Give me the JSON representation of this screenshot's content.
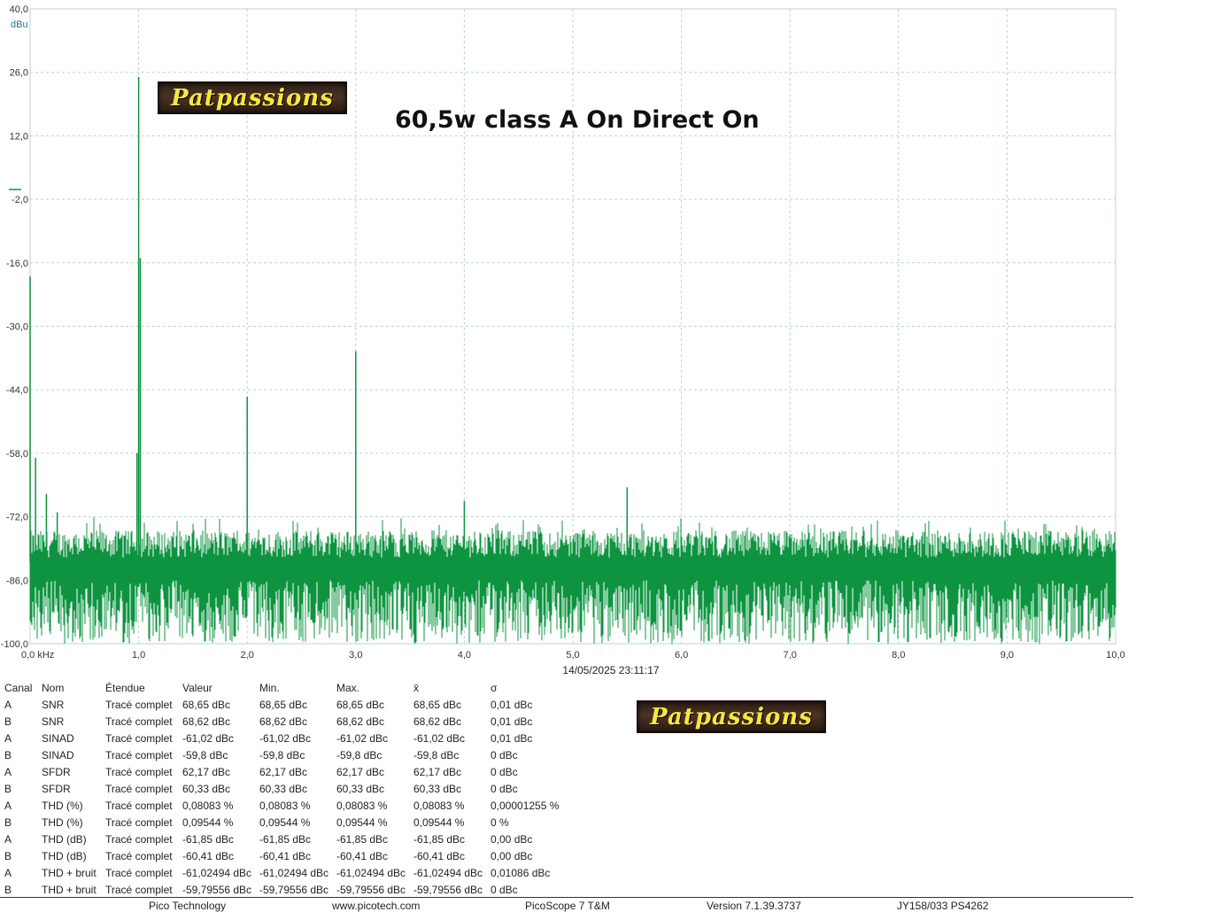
{
  "chart_data": {
    "type": "line",
    "title": "60,5w class A On Direct On",
    "xlabel": "kHz",
    "ylabel": "dBu",
    "xlim": [
      0.0,
      10.0
    ],
    "ylim": [
      -100.0,
      40.0
    ],
    "grid": true,
    "x_ticks": [
      "0,0 kHz",
      "1,0",
      "2,0",
      "3,0",
      "4,0",
      "5,0",
      "6,0",
      "7,0",
      "8,0",
      "9,0",
      "10,0"
    ],
    "y_ticks": [
      "40,0",
      "26,0",
      "12,0",
      "-2,0",
      "-16,0",
      "-30,0",
      "-44,0",
      "-58,0",
      "-72,0",
      "-86,0",
      "-100,0"
    ],
    "y_unit": "dBu",
    "noise_floor": {
      "center": -82,
      "upper": -75,
      "lower": -100
    },
    "series": [
      {
        "color": "#0e9440",
        "peaks": [
          {
            "x": 0.0,
            "y": -19.0
          },
          {
            "x": 0.05,
            "y": -59.0
          },
          {
            "x": 0.15,
            "y": -67.0
          },
          {
            "x": 0.25,
            "y": -71.0
          },
          {
            "x": 1.0,
            "y": 25.0
          },
          {
            "x": 0.985,
            "y": -58.0
          },
          {
            "x": 1.015,
            "y": -15.0
          },
          {
            "x": 2.0,
            "y": -45.5
          },
          {
            "x": 3.0,
            "y": -35.5
          },
          {
            "x": 4.0,
            "y": -68.5
          },
          {
            "x": 5.5,
            "y": -65.5
          }
        ]
      }
    ]
  },
  "timestamp": "14/05/2025 23:11:17",
  "logo_text": "Patpassions",
  "measurements": {
    "headers": [
      "Canal",
      "Nom",
      "Étendue",
      "Valeur",
      "Min.",
      "Max.",
      "x̄",
      "σ"
    ],
    "rows": [
      [
        "A",
        "SNR",
        "Tracé complet",
        "68,65 dBc",
        "68,65 dBc",
        "68,65 dBc",
        "68,65 dBc",
        "0,01 dBc"
      ],
      [
        "B",
        "SNR",
        "Tracé complet",
        "68,62 dBc",
        "68,62 dBc",
        "68,62 dBc",
        "68,62 dBc",
        "0,01 dBc"
      ],
      [
        "A",
        "SINAD",
        "Tracé complet",
        "-61,02 dBc",
        "-61,02 dBc",
        "-61,02 dBc",
        "-61,02 dBc",
        "0,01 dBc"
      ],
      [
        "B",
        "SINAD",
        "Tracé complet",
        "-59,8 dBc",
        "-59,8 dBc",
        "-59,8 dBc",
        "-59,8 dBc",
        "0 dBc"
      ],
      [
        "A",
        "SFDR",
        "Tracé complet",
        "62,17 dBc",
        "62,17 dBc",
        "62,17 dBc",
        "62,17 dBc",
        "0 dBc"
      ],
      [
        "B",
        "SFDR",
        "Tracé complet",
        "60,33 dBc",
        "60,33 dBc",
        "60,33 dBc",
        "60,33 dBc",
        "0 dBc"
      ],
      [
        "A",
        "THD (%)",
        "Tracé complet",
        "0,08083 %",
        "0,08083 %",
        "0,08083 %",
        "0,08083 %",
        "0,00001255 %"
      ],
      [
        "B",
        "THD (%)",
        "Tracé complet",
        "0,09544 %",
        "0,09544 %",
        "0,09544 %",
        "0,09544 %",
        "0 %"
      ],
      [
        "A",
        "THD (dB)",
        "Tracé complet",
        "-61,85 dBc",
        "-61,85 dBc",
        "-61,85 dBc",
        "-61,85 dBc",
        "0,00 dBc"
      ],
      [
        "B",
        "THD (dB)",
        "Tracé complet",
        "-60,41 dBc",
        "-60,41 dBc",
        "-60,41 dBc",
        "-60,41 dBc",
        "0,00 dBc"
      ],
      [
        "A",
        "THD + bruit",
        "Tracé complet",
        "-61,02494 dBc",
        "-61,02494 dBc",
        "-61,02494 dBc",
        "-61,02494 dBc",
        "0,01086 dBc"
      ],
      [
        "B",
        "THD + bruit",
        "Tracé complet",
        "-59,79556 dBc",
        "-59,79556 dBc",
        "-59,79556 dBc",
        "-59,79556 dBc",
        "0 dBc"
      ]
    ]
  },
  "footer": {
    "company": "Pico Technology",
    "website": "www.picotech.com",
    "product": "PicoScope 7 T&M",
    "version": "Version 7.1.39.3737",
    "device": "JY158/033 PS4262"
  }
}
